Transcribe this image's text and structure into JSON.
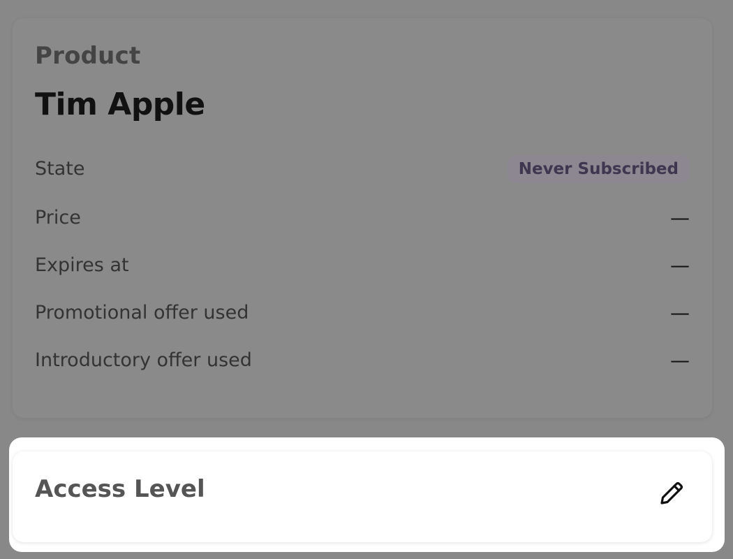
{
  "product": {
    "section_label": "Product",
    "name": "Tim Apple",
    "rows": [
      {
        "label": "State",
        "value": "Never Subscribed"
      },
      {
        "label": "Price",
        "value": "—"
      },
      {
        "label": "Expires at",
        "value": "—"
      },
      {
        "label": "Promotional offer used",
        "value": "—"
      },
      {
        "label": "Introductory offer used",
        "value": "—"
      }
    ]
  },
  "access": {
    "title": "Access Level",
    "edit_icon": "pencil-icon"
  }
}
